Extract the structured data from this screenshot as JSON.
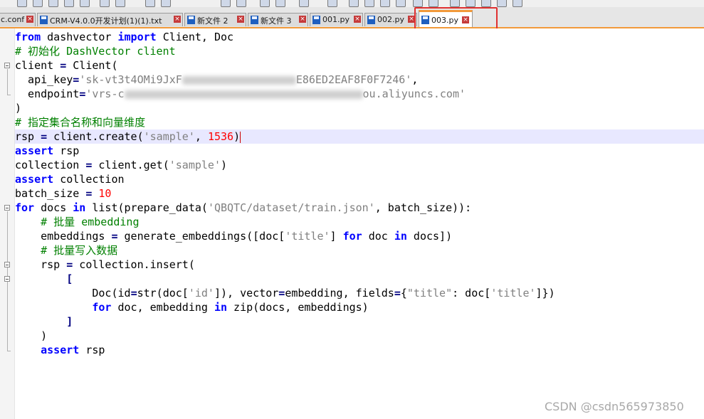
{
  "tabs": [
    {
      "label": "c.conf",
      "close": "×"
    },
    {
      "label": "CRM-V4.0.0开发计划(1)(1).txt",
      "close": "×"
    },
    {
      "label": "新文件 2",
      "close": "×"
    },
    {
      "label": "新文件 3",
      "close": "×"
    },
    {
      "label": "001.py",
      "close": "×"
    },
    {
      "label": "002.py",
      "close": "×"
    },
    {
      "label": "003.py",
      "close": "×",
      "active": true
    }
  ],
  "code": {
    "l1": {
      "a": "from",
      "b": " dashvector ",
      "c": "import",
      "d": " Client, Doc"
    },
    "l2": "# 初始化 DashVector client",
    "l3": {
      "a": "client ",
      "b": "=",
      "c": " Client("
    },
    "l4": {
      "a": "  api_key",
      "b": "=",
      "c": "'sk-vt3t4OMi9JxF",
      "d": "E86ED2EAF8F0F7246'",
      "e": ","
    },
    "l5": {
      "a": "  endpoint",
      "b": "=",
      "c": "'vrs-c",
      "d": "ou.aliyuncs.com'"
    },
    "l6": ")",
    "l7": "# 指定集合名称和向量维度",
    "l8": {
      "a": "rsp ",
      "b": "=",
      "c": " client.create(",
      "d": "'sample'",
      "e": ", ",
      "f": "1536",
      "g": ")"
    },
    "l9": {
      "a": "assert",
      "b": " rsp"
    },
    "l10": {
      "a": "collection ",
      "b": "=",
      "c": " client.get(",
      "d": "'sample'",
      "e": ")"
    },
    "l11": {
      "a": "assert",
      "b": " collection"
    },
    "l12": {
      "a": "batch_size ",
      "b": "=",
      "c": " ",
      "d": "10"
    },
    "l13": {
      "a": "for",
      "b": " docs ",
      "c": "in",
      "d": " list(prepare_data(",
      "e": "'QBQTC/dataset/train.json'",
      "f": ", batch_size)):"
    },
    "l14": "    # 批量 embedding",
    "l15": {
      "a": "    embeddings ",
      "b": "=",
      "c": " generate_embeddings([doc[",
      "d": "'title'",
      "e": "] ",
      "f": "for",
      "g": " doc ",
      "h": "in",
      "i": " docs])"
    },
    "l16": "    # 批量写入数据",
    "l17": {
      "a": "    rsp ",
      "b": "=",
      "c": " collection.insert("
    },
    "l18": "        [",
    "l19": {
      "a": "            Doc(id",
      "b": "=",
      "c": "str(doc[",
      "d": "'id'",
      "e": "]), vector",
      "f": "=",
      "g": "embedding, fields",
      "h": "=",
      "i": "{",
      "j": "\"title\"",
      "k": ": doc[",
      "l": "'title'",
      "m": "]})"
    },
    "l20": {
      "a": "            ",
      "b": "for",
      "c": " doc, embedding ",
      "d": "in",
      "e": " zip(docs, embeddings)"
    },
    "l21": "        ]",
    "l22": "    )",
    "l23": {
      "a": "    ",
      "b": "assert",
      "c": " rsp"
    }
  },
  "watermark": "CSDN @csdn565973850"
}
